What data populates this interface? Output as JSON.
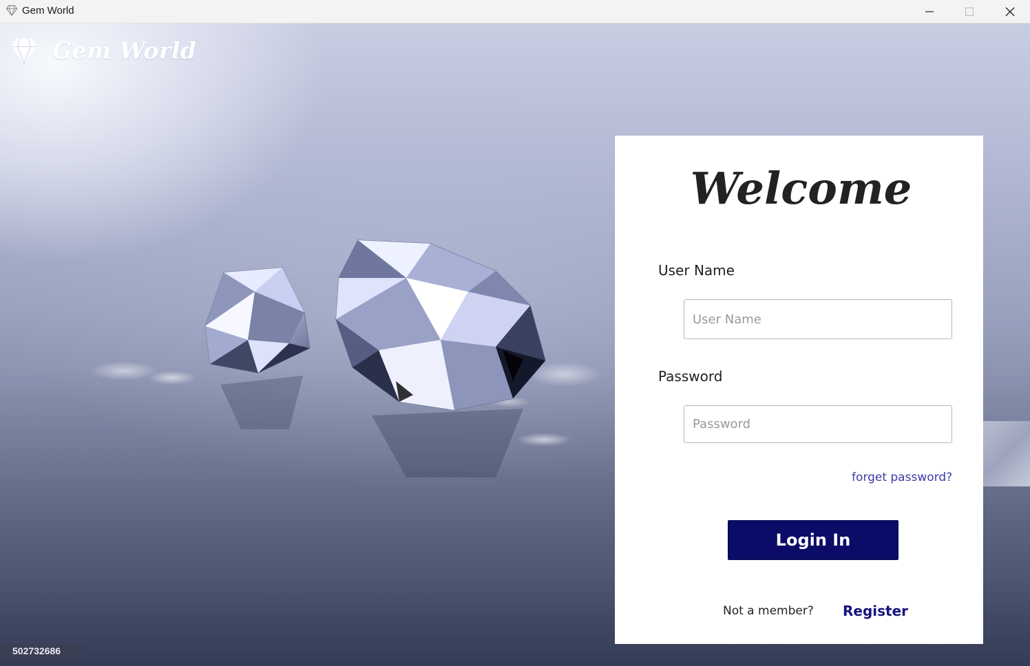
{
  "window": {
    "title": "Gem World",
    "app_icon": "diamond-icon",
    "controls": [
      "minimize-icon",
      "maximize-icon",
      "close-icon"
    ]
  },
  "brand": {
    "logo_icon": "diamond-icon",
    "name": "Gem World"
  },
  "login": {
    "heading": "Welcome",
    "username_label": "User Name",
    "username_placeholder": "User Name",
    "username_value": "",
    "password_label": "Password",
    "password_placeholder": "Password",
    "password_value": "",
    "forgot_link": "forget password?",
    "submit_label": "Login In",
    "register_prompt": "Not a member?",
    "register_link": "Register"
  },
  "watermark": "502732686",
  "colors": {
    "primary_button": "#0b0b68",
    "register_link": "#16127f",
    "forgot_link": "#3d3aa8",
    "card_background": "#ffffff"
  }
}
